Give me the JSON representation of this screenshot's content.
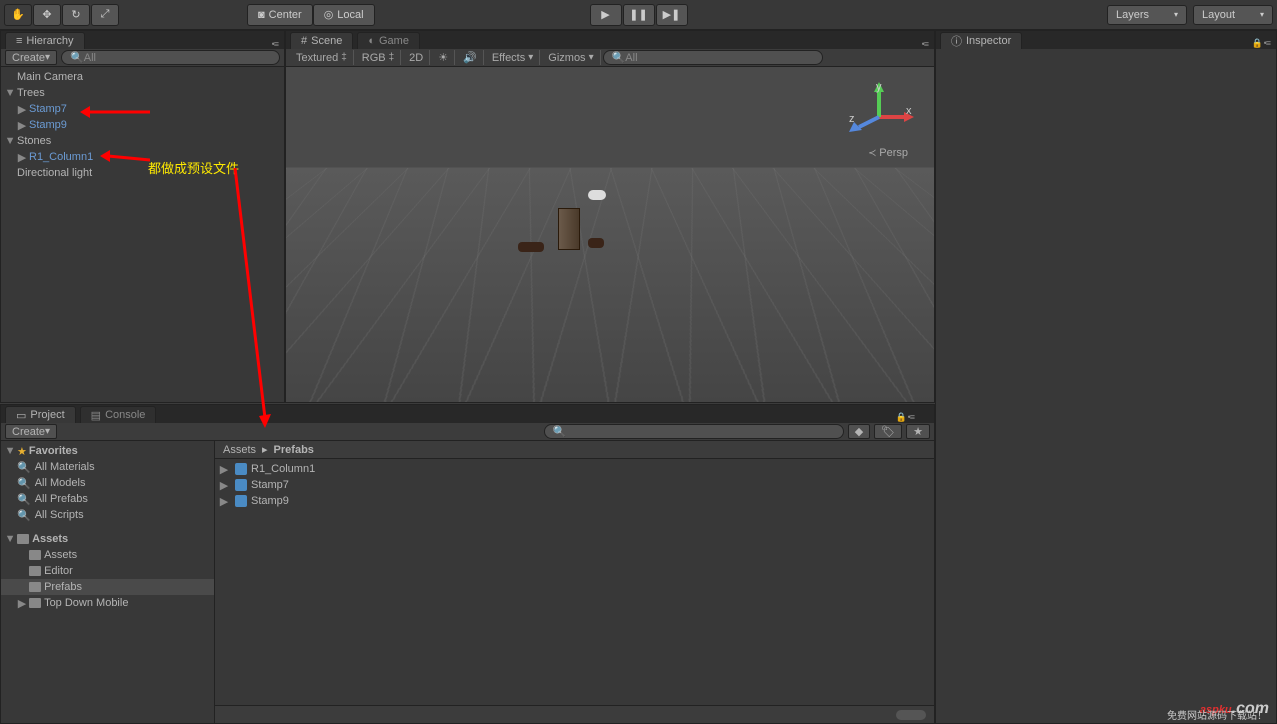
{
  "toolbar": {
    "pivot_center": "Center",
    "pivot_local": "Local",
    "layers": "Layers",
    "layout": "Layout"
  },
  "hierarchy": {
    "title": "Hierarchy",
    "create": "Create",
    "search_placeholder": "All",
    "items": [
      {
        "label": "Main Camera",
        "indent": 0,
        "prefab": false,
        "fold": ""
      },
      {
        "label": "Trees",
        "indent": 0,
        "prefab": false,
        "fold": "▼"
      },
      {
        "label": "Stamp7",
        "indent": 1,
        "prefab": true,
        "fold": "▶"
      },
      {
        "label": "Stamp9",
        "indent": 1,
        "prefab": true,
        "fold": "▶"
      },
      {
        "label": "Stones",
        "indent": 0,
        "prefab": false,
        "fold": "▼"
      },
      {
        "label": "R1_Column1",
        "indent": 1,
        "prefab": true,
        "fold": "▶"
      },
      {
        "label": "Directional light",
        "indent": 0,
        "prefab": false,
        "fold": ""
      }
    ]
  },
  "scene": {
    "tab_scene": "Scene",
    "tab_game": "Game",
    "shading": "Textured",
    "render": "RGB",
    "mode2d": "2D",
    "effects": "Effects",
    "gizmos": "Gizmos",
    "search_placeholder": "All",
    "persp": "Persp",
    "axis_x": "x",
    "axis_y": "y",
    "axis_z": "z"
  },
  "project": {
    "tab_project": "Project",
    "tab_console": "Console",
    "create": "Create",
    "favorites": "Favorites",
    "fav_items": [
      "All Materials",
      "All Models",
      "All Prefabs",
      "All Scripts"
    ],
    "assets": "Assets",
    "folders": [
      "Assets",
      "Editor",
      "Prefabs",
      "Top Down Mobile"
    ],
    "selected_folder": "Prefabs",
    "breadcrumb": [
      "Assets",
      "Prefabs"
    ],
    "content": [
      "R1_Column1",
      "Stamp7",
      "Stamp9"
    ]
  },
  "inspector": {
    "title": "Inspector"
  },
  "annotation": "都做成预设文件",
  "watermark": {
    "brand": "aspku",
    "domain": ".com",
    "sub": "免费网站源码下载站！"
  }
}
